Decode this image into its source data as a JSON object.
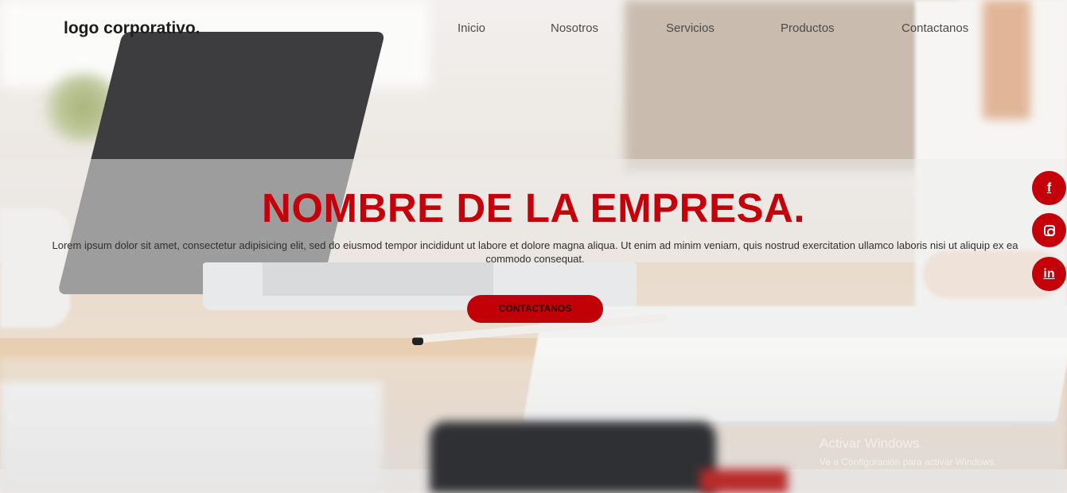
{
  "header": {
    "logo": "logo corporativo.",
    "nav": [
      "Inicio",
      "Nosotros",
      "Servicios",
      "Productos",
      "Contactanos"
    ]
  },
  "hero": {
    "title": "NOMBRE DE LA EMPRESA.",
    "text": "Lorem ipsum dolor sit amet, consectetur adipisicing elit, sed do eiusmod tempor incididunt ut labore et dolore magna aliqua. Ut enim ad minim veniam, quis nostrud exercitation ullamco laboris nisi ut aliquip ex ea commodo consequat.",
    "cta_label": "CONTACTANOS"
  },
  "social": [
    {
      "name": "facebook-icon",
      "glyph": "f"
    },
    {
      "name": "instagram-icon",
      "glyph": ""
    },
    {
      "name": "linkedin-icon",
      "glyph": "in"
    }
  ],
  "watermark": {
    "title": "Activar Windows",
    "subtitle": "Ve a Configuración para activar Windows."
  },
  "colors": {
    "accent": "#c4000b",
    "band": "#ececec"
  }
}
